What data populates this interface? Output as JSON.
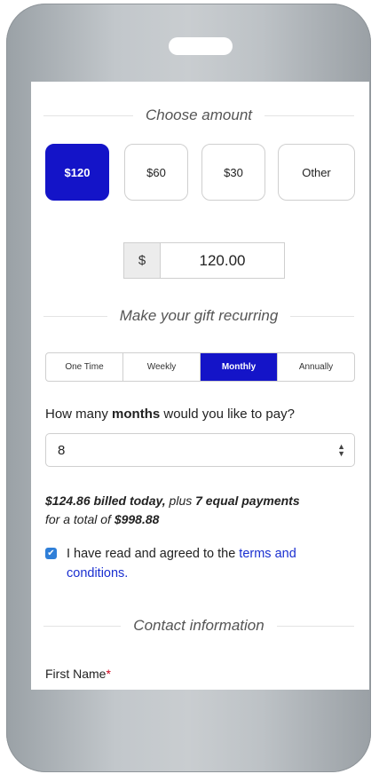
{
  "sections": {
    "choose_amount": "Choose amount",
    "recurring": "Make your gift recurring",
    "contact": "Contact information"
  },
  "amount_options": [
    "$120",
    "$60",
    "$30",
    "Other"
  ],
  "selected_amount": "$120",
  "amount_field": {
    "currency": "$",
    "value": "120.00"
  },
  "frequency_options": [
    "One Time",
    "Weekly",
    "Monthly",
    "Annually"
  ],
  "selected_frequency": "Monthly",
  "months_question": {
    "pre": "How many ",
    "bold": "months",
    "post": " would you like to pay?"
  },
  "months_select": {
    "value": "8"
  },
  "summary": {
    "billed_today": "$124.86 billed today,",
    "plus": " plus ",
    "payments": "7 equal payments",
    "for_total": "for a total of ",
    "total": "$998.88"
  },
  "terms": {
    "text": "I have read and agreed to the ",
    "link": "terms and conditions.",
    "checked": true
  },
  "first_name": {
    "label": "First Name",
    "required_mark": "*"
  },
  "colors": {
    "accent": "#1414c8",
    "link": "#1a2fd0",
    "required": "#d0021b",
    "checkbox": "#2f7fd8"
  }
}
